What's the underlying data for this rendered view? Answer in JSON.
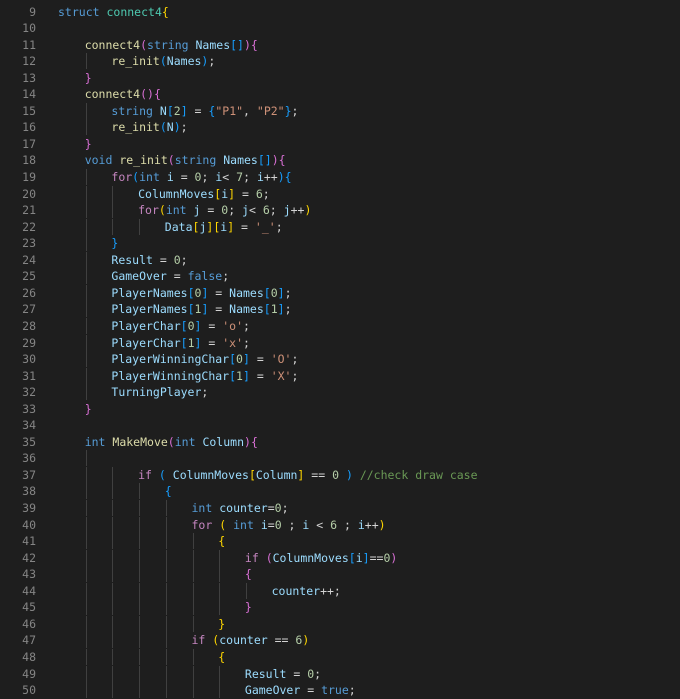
{
  "editor": {
    "language": "cpp",
    "theme": "dark",
    "colors": {
      "background": "#1e1e1e",
      "line_number": "#858585",
      "keyword": "#569cd6",
      "control": "#c586c0",
      "type": "#4ec9b0",
      "function": "#dcdcaa",
      "variable": "#9cdcfe",
      "plain": "#d4d4d4",
      "number": "#b5cea8",
      "string": "#ce9178",
      "comment": "#6a9955",
      "bracket_level_1": "#ffd700",
      "bracket_level_2": "#da70d6",
      "bracket_level_3": "#179fff"
    },
    "lines": [
      {
        "n": "9",
        "indent": 0,
        "tokens": [
          [
            "keyword",
            "struct"
          ],
          [
            "plain",
            " "
          ],
          [
            "type",
            "connect4"
          ],
          [
            "b1",
            "{"
          ]
        ]
      },
      {
        "n": "10",
        "indent": 0,
        "tokens": []
      },
      {
        "n": "11",
        "indent": 1,
        "tokens": [
          [
            "func",
            "connect4"
          ],
          [
            "b2",
            "("
          ],
          [
            "keyword",
            "string"
          ],
          [
            "plain",
            " "
          ],
          [
            "var",
            "Names"
          ],
          [
            "b3",
            "[]"
          ],
          [
            "b2",
            ")"
          ],
          [
            "b2",
            "{"
          ]
        ]
      },
      {
        "n": "12",
        "indent": 2,
        "tokens": [
          [
            "func",
            "re_init"
          ],
          [
            "b3",
            "("
          ],
          [
            "var",
            "Names"
          ],
          [
            "b3",
            ")"
          ],
          [
            "plain",
            ";"
          ]
        ]
      },
      {
        "n": "13",
        "indent": 1,
        "tokens": [
          [
            "b2",
            "}"
          ]
        ]
      },
      {
        "n": "14",
        "indent": 1,
        "tokens": [
          [
            "func",
            "connect4"
          ],
          [
            "b2",
            "()"
          ],
          [
            "b2",
            "{"
          ]
        ]
      },
      {
        "n": "15",
        "indent": 2,
        "tokens": [
          [
            "keyword",
            "string"
          ],
          [
            "plain",
            " "
          ],
          [
            "var",
            "N"
          ],
          [
            "b3",
            "["
          ],
          [
            "num",
            "2"
          ],
          [
            "b3",
            "]"
          ],
          [
            "plain",
            " = "
          ],
          [
            "b3",
            "{"
          ],
          [
            "str",
            "\"P1\""
          ],
          [
            "plain",
            ", "
          ],
          [
            "str",
            "\"P2\""
          ],
          [
            "b3",
            "}"
          ],
          [
            "plain",
            ";"
          ]
        ]
      },
      {
        "n": "16",
        "indent": 2,
        "tokens": [
          [
            "func",
            "re_init"
          ],
          [
            "b3",
            "("
          ],
          [
            "var",
            "N"
          ],
          [
            "b3",
            ")"
          ],
          [
            "plain",
            ";"
          ]
        ]
      },
      {
        "n": "17",
        "indent": 1,
        "tokens": [
          [
            "b2",
            "}"
          ]
        ]
      },
      {
        "n": "18",
        "indent": 1,
        "tokens": [
          [
            "keyword",
            "void"
          ],
          [
            "plain",
            " "
          ],
          [
            "func",
            "re_init"
          ],
          [
            "b2",
            "("
          ],
          [
            "keyword",
            "string"
          ],
          [
            "plain",
            " "
          ],
          [
            "var",
            "Names"
          ],
          [
            "b3",
            "[]"
          ],
          [
            "b2",
            ")"
          ],
          [
            "b2",
            "{"
          ]
        ]
      },
      {
        "n": "19",
        "indent": 2,
        "tokens": [
          [
            "control",
            "for"
          ],
          [
            "b3",
            "("
          ],
          [
            "keyword",
            "int"
          ],
          [
            "plain",
            " "
          ],
          [
            "var",
            "i"
          ],
          [
            "plain",
            " = "
          ],
          [
            "num",
            "0"
          ],
          [
            "plain",
            "; "
          ],
          [
            "var",
            "i"
          ],
          [
            "plain",
            "< "
          ],
          [
            "num",
            "7"
          ],
          [
            "plain",
            "; "
          ],
          [
            "var",
            "i"
          ],
          [
            "plain",
            "++"
          ],
          [
            "b3",
            ")"
          ],
          [
            "b3",
            "{"
          ]
        ]
      },
      {
        "n": "20",
        "indent": 3,
        "tokens": [
          [
            "var",
            "ColumnMoves"
          ],
          [
            "b1",
            "["
          ],
          [
            "var",
            "i"
          ],
          [
            "b1",
            "]"
          ],
          [
            "plain",
            " = "
          ],
          [
            "num",
            "6"
          ],
          [
            "plain",
            ";"
          ]
        ]
      },
      {
        "n": "21",
        "indent": 3,
        "tokens": [
          [
            "control",
            "for"
          ],
          [
            "b1",
            "("
          ],
          [
            "keyword",
            "int"
          ],
          [
            "plain",
            " "
          ],
          [
            "var",
            "j"
          ],
          [
            "plain",
            " = "
          ],
          [
            "num",
            "0"
          ],
          [
            "plain",
            "; "
          ],
          [
            "var",
            "j"
          ],
          [
            "plain",
            "< "
          ],
          [
            "num",
            "6"
          ],
          [
            "plain",
            "; "
          ],
          [
            "var",
            "j"
          ],
          [
            "plain",
            "++"
          ],
          [
            "b1",
            ")"
          ]
        ]
      },
      {
        "n": "22",
        "indent": 4,
        "tokens": [
          [
            "var",
            "Data"
          ],
          [
            "b1",
            "["
          ],
          [
            "var",
            "j"
          ],
          [
            "b1",
            "]"
          ],
          [
            "b1",
            "["
          ],
          [
            "var",
            "i"
          ],
          [
            "b1",
            "]"
          ],
          [
            "plain",
            " = "
          ],
          [
            "str",
            "'_'"
          ],
          [
            "plain",
            ";"
          ]
        ]
      },
      {
        "n": "23",
        "indent": 2,
        "tokens": [
          [
            "b3",
            "}"
          ]
        ]
      },
      {
        "n": "24",
        "indent": 2,
        "tokens": [
          [
            "var",
            "Result"
          ],
          [
            "plain",
            " = "
          ],
          [
            "num",
            "0"
          ],
          [
            "plain",
            ";"
          ]
        ]
      },
      {
        "n": "25",
        "indent": 2,
        "tokens": [
          [
            "var",
            "GameOver"
          ],
          [
            "plain",
            " = "
          ],
          [
            "keyword",
            "false"
          ],
          [
            "plain",
            ";"
          ]
        ]
      },
      {
        "n": "26",
        "indent": 2,
        "tokens": [
          [
            "var",
            "PlayerNames"
          ],
          [
            "b3",
            "["
          ],
          [
            "num",
            "0"
          ],
          [
            "b3",
            "]"
          ],
          [
            "plain",
            " = "
          ],
          [
            "var",
            "Names"
          ],
          [
            "b3",
            "["
          ],
          [
            "num",
            "0"
          ],
          [
            "b3",
            "]"
          ],
          [
            "plain",
            ";"
          ]
        ]
      },
      {
        "n": "27",
        "indent": 2,
        "tokens": [
          [
            "var",
            "PlayerNames"
          ],
          [
            "b3",
            "["
          ],
          [
            "num",
            "1"
          ],
          [
            "b3",
            "]"
          ],
          [
            "plain",
            " = "
          ],
          [
            "var",
            "Names"
          ],
          [
            "b3",
            "["
          ],
          [
            "num",
            "1"
          ],
          [
            "b3",
            "]"
          ],
          [
            "plain",
            ";"
          ]
        ]
      },
      {
        "n": "28",
        "indent": 2,
        "tokens": [
          [
            "var",
            "PlayerChar"
          ],
          [
            "b3",
            "["
          ],
          [
            "num",
            "0"
          ],
          [
            "b3",
            "]"
          ],
          [
            "plain",
            " = "
          ],
          [
            "str",
            "'o'"
          ],
          [
            "plain",
            ";"
          ]
        ]
      },
      {
        "n": "29",
        "indent": 2,
        "tokens": [
          [
            "var",
            "PlayerChar"
          ],
          [
            "b3",
            "["
          ],
          [
            "num",
            "1"
          ],
          [
            "b3",
            "]"
          ],
          [
            "plain",
            " = "
          ],
          [
            "str",
            "'x'"
          ],
          [
            "plain",
            ";"
          ]
        ]
      },
      {
        "n": "30",
        "indent": 2,
        "tokens": [
          [
            "var",
            "PlayerWinningChar"
          ],
          [
            "b3",
            "["
          ],
          [
            "num",
            "0"
          ],
          [
            "b3",
            "]"
          ],
          [
            "plain",
            " = "
          ],
          [
            "str",
            "'O'"
          ],
          [
            "plain",
            ";"
          ]
        ]
      },
      {
        "n": "31",
        "indent": 2,
        "tokens": [
          [
            "var",
            "PlayerWinningChar"
          ],
          [
            "b3",
            "["
          ],
          [
            "num",
            "1"
          ],
          [
            "b3",
            "]"
          ],
          [
            "plain",
            " = "
          ],
          [
            "str",
            "'X'"
          ],
          [
            "plain",
            ";"
          ]
        ]
      },
      {
        "n": "32",
        "indent": 2,
        "tokens": [
          [
            "var",
            "TurningPlayer"
          ],
          [
            "plain",
            ";"
          ]
        ]
      },
      {
        "n": "33",
        "indent": 1,
        "tokens": [
          [
            "b2",
            "}"
          ]
        ]
      },
      {
        "n": "34",
        "indent": 1,
        "tokens": []
      },
      {
        "n": "35",
        "indent": 1,
        "tokens": [
          [
            "keyword",
            "int"
          ],
          [
            "plain",
            " "
          ],
          [
            "func",
            "MakeMove"
          ],
          [
            "b2",
            "("
          ],
          [
            "keyword",
            "int"
          ],
          [
            "plain",
            " "
          ],
          [
            "var",
            "Column"
          ],
          [
            "b2",
            ")"
          ],
          [
            "b2",
            "{"
          ]
        ]
      },
      {
        "n": "36",
        "indent": 2,
        "tokens": []
      },
      {
        "n": "37",
        "indent": 3,
        "tokens": [
          [
            "control",
            "if"
          ],
          [
            "plain",
            " "
          ],
          [
            "b3",
            "("
          ],
          [
            "plain",
            " "
          ],
          [
            "var",
            "ColumnMoves"
          ],
          [
            "b1",
            "["
          ],
          [
            "var",
            "Column"
          ],
          [
            "b1",
            "]"
          ],
          [
            "plain",
            " == "
          ],
          [
            "num",
            "0"
          ],
          [
            "plain",
            " "
          ],
          [
            "b3",
            ")"
          ],
          [
            "plain",
            " "
          ],
          [
            "comment",
            "//check draw case"
          ]
        ]
      },
      {
        "n": "38",
        "indent": 4,
        "tokens": [
          [
            "b3",
            "{"
          ]
        ]
      },
      {
        "n": "39",
        "indent": 5,
        "tokens": [
          [
            "keyword",
            "int"
          ],
          [
            "plain",
            " "
          ],
          [
            "var",
            "counter"
          ],
          [
            "plain",
            "="
          ],
          [
            "num",
            "0"
          ],
          [
            "plain",
            ";"
          ]
        ]
      },
      {
        "n": "40",
        "indent": 5,
        "tokens": [
          [
            "control",
            "for"
          ],
          [
            "plain",
            " "
          ],
          [
            "b1",
            "("
          ],
          [
            "plain",
            " "
          ],
          [
            "keyword",
            "int"
          ],
          [
            "plain",
            " "
          ],
          [
            "var",
            "i"
          ],
          [
            "plain",
            "="
          ],
          [
            "num",
            "0"
          ],
          [
            "plain",
            " ; "
          ],
          [
            "var",
            "i"
          ],
          [
            "plain",
            " < "
          ],
          [
            "num",
            "6"
          ],
          [
            "plain",
            " ; "
          ],
          [
            "var",
            "i"
          ],
          [
            "plain",
            "++"
          ],
          [
            "b1",
            ")"
          ]
        ]
      },
      {
        "n": "41",
        "indent": 6,
        "tokens": [
          [
            "b1",
            "{"
          ]
        ]
      },
      {
        "n": "42",
        "indent": 7,
        "tokens": [
          [
            "control",
            "if"
          ],
          [
            "plain",
            " "
          ],
          [
            "b2",
            "("
          ],
          [
            "var",
            "ColumnMoves"
          ],
          [
            "b3",
            "["
          ],
          [
            "var",
            "i"
          ],
          [
            "b3",
            "]"
          ],
          [
            "plain",
            "=="
          ],
          [
            "num",
            "0"
          ],
          [
            "b2",
            ")"
          ]
        ]
      },
      {
        "n": "43",
        "indent": 7,
        "tokens": [
          [
            "b2",
            "{"
          ]
        ]
      },
      {
        "n": "44",
        "indent": 8,
        "tokens": [
          [
            "var",
            "counter"
          ],
          [
            "plain",
            "++;"
          ]
        ]
      },
      {
        "n": "45",
        "indent": 7,
        "tokens": [
          [
            "b2",
            "}"
          ]
        ]
      },
      {
        "n": "46",
        "indent": 6,
        "tokens": [
          [
            "b1",
            "}"
          ]
        ]
      },
      {
        "n": "47",
        "indent": 5,
        "tokens": [
          [
            "control",
            "if"
          ],
          [
            "plain",
            " "
          ],
          [
            "b1",
            "("
          ],
          [
            "var",
            "counter"
          ],
          [
            "plain",
            " == "
          ],
          [
            "num",
            "6"
          ],
          [
            "b1",
            ")"
          ]
        ]
      },
      {
        "n": "48",
        "indent": 6,
        "tokens": [
          [
            "b1",
            "{"
          ]
        ]
      },
      {
        "n": "49",
        "indent": 7,
        "tokens": [
          [
            "var",
            "Result"
          ],
          [
            "plain",
            " = "
          ],
          [
            "num",
            "0"
          ],
          [
            "plain",
            ";"
          ]
        ]
      },
      {
        "n": "50",
        "indent": 7,
        "tokens": [
          [
            "var",
            "GameOver"
          ],
          [
            "plain",
            " = "
          ],
          [
            "keyword",
            "true"
          ],
          [
            "plain",
            ";"
          ]
        ]
      }
    ]
  }
}
